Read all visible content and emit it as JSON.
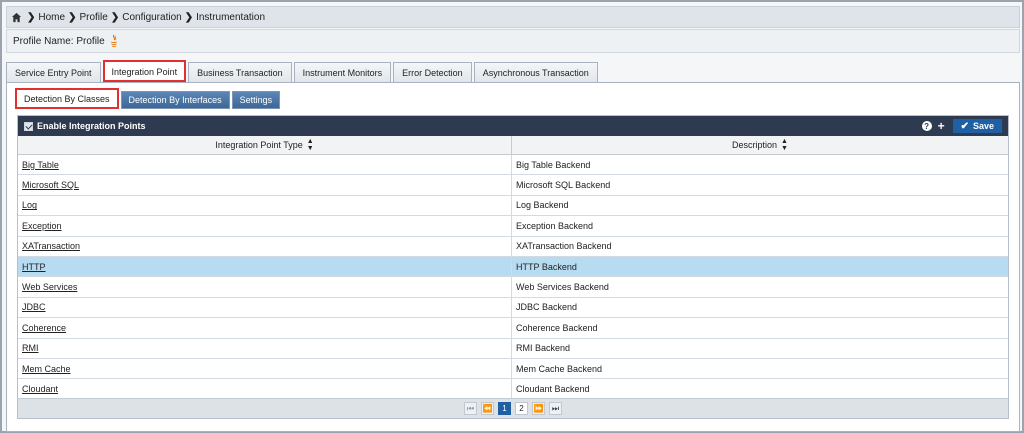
{
  "breadcrumb": {
    "items": [
      "Home",
      "Profile",
      "Configuration",
      "Instrumentation"
    ]
  },
  "profile": {
    "label": "Profile Name: Profile"
  },
  "main_tabs": [
    "Service Entry Point",
    "Integration Point",
    "Business Transaction",
    "Instrument Monitors",
    "Error Detection",
    "Asynchronous Transaction"
  ],
  "main_tab_active": "Integration Point",
  "sub_tabs": [
    "Detection By Classes",
    "Detection By Interfaces",
    "Settings"
  ],
  "sub_tab_active": "Detection By Classes",
  "grid": {
    "toolbar_title": "Enable Integration Points",
    "help_symbol": "?",
    "add_symbol": "+",
    "save_label": "Save",
    "columns": [
      "Integration Point Type",
      "Description"
    ],
    "rows": [
      {
        "type": "Big Table",
        "description": "Big Table Backend"
      },
      {
        "type": "Microsoft SQL",
        "description": "Microsoft SQL Backend"
      },
      {
        "type": "Log",
        "description": "Log Backend"
      },
      {
        "type": "Exception",
        "description": "Exception Backend"
      },
      {
        "type": "XATransaction",
        "description": "XATransaction Backend"
      },
      {
        "type": "HTTP",
        "description": "HTTP Backend",
        "selected": true
      },
      {
        "type": "Web Services",
        "description": "Web Services Backend"
      },
      {
        "type": "JDBC",
        "description": "JDBC Backend"
      },
      {
        "type": "Coherence",
        "description": "Coherence Backend"
      },
      {
        "type": "RMI",
        "description": "RMI Backend"
      },
      {
        "type": "Mem Cache",
        "description": "Mem Cache Backend"
      },
      {
        "type": "Cloudant",
        "description": "Cloudant Backend"
      }
    ]
  },
  "pager": {
    "pages": [
      "1",
      "2"
    ],
    "current": "1"
  },
  "colors": {
    "toolbar_bg": "#2e3a4f",
    "save_bg": "#1f5fa4",
    "selected_row": "#b7dcf1",
    "highlight_outline": "#e03030",
    "subtab_bg": "#3c6797"
  }
}
